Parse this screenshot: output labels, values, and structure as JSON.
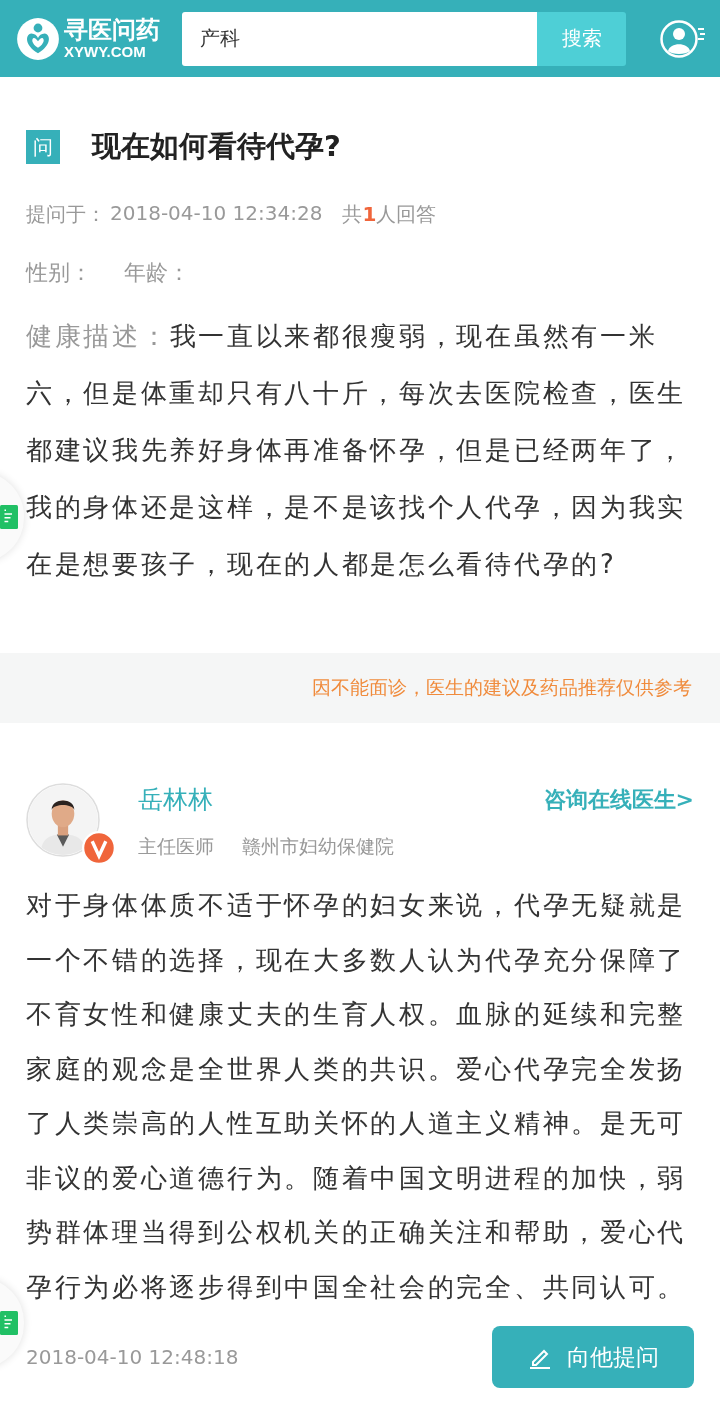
{
  "header": {
    "logo_text": "寻医问药",
    "logo_domain": "XYWY.COM",
    "search": {
      "value": "产科"
    },
    "search_button": "搜索"
  },
  "question": {
    "tag": "问",
    "title": "现在如何看待代孕?",
    "asked_label": "提问于：",
    "asked_time": "2018-04-10 12:34:28",
    "count_prefix": "共",
    "count": "1",
    "count_suffix": "人回答",
    "gender_label": "性别：",
    "age_label": "年龄：",
    "description_label": "健康描述：",
    "description": "我一直以来都很瘦弱，现在虽然有一米六，但是体重却只有八十斤，每次去医院检查，医生都建议我先养好身体再准备怀孕，但是已经两年了，我的身体还是这样，是不是该找个人代孕，因为我实在是想要孩子，现在的人都是怎么看待代孕的?"
  },
  "notice": "因不能面诊，医生的建议及药品推荐仅供参考",
  "answer": {
    "doctor_name": "岳林林",
    "verified": true,
    "consult_link": "咨询在线医生>",
    "doctor_title": "主任医师",
    "hospital": "赣州市妇幼保健院",
    "text": "对于身体体质不适于怀孕的妇女来说，代孕无疑就是一个不错的选择，现在大多数人认为代孕充分保障了不育女性和健康丈夫的生育人权。血脉的延续和完整家庭的观念是全世界人类的共识。爱心代孕完全发扬了人类崇高的人性互助关怀的人道主义精神。是无可非议的爱心道德行为。随着中国文明进程的加快，弱势群体理当得到公权机关的正确关注和帮助，爱心代孕行为必将逐步得到中国全社会的完全、共同认可。",
    "time": "2018-04-10 12:48:18",
    "ask_button": "向他提问"
  }
}
